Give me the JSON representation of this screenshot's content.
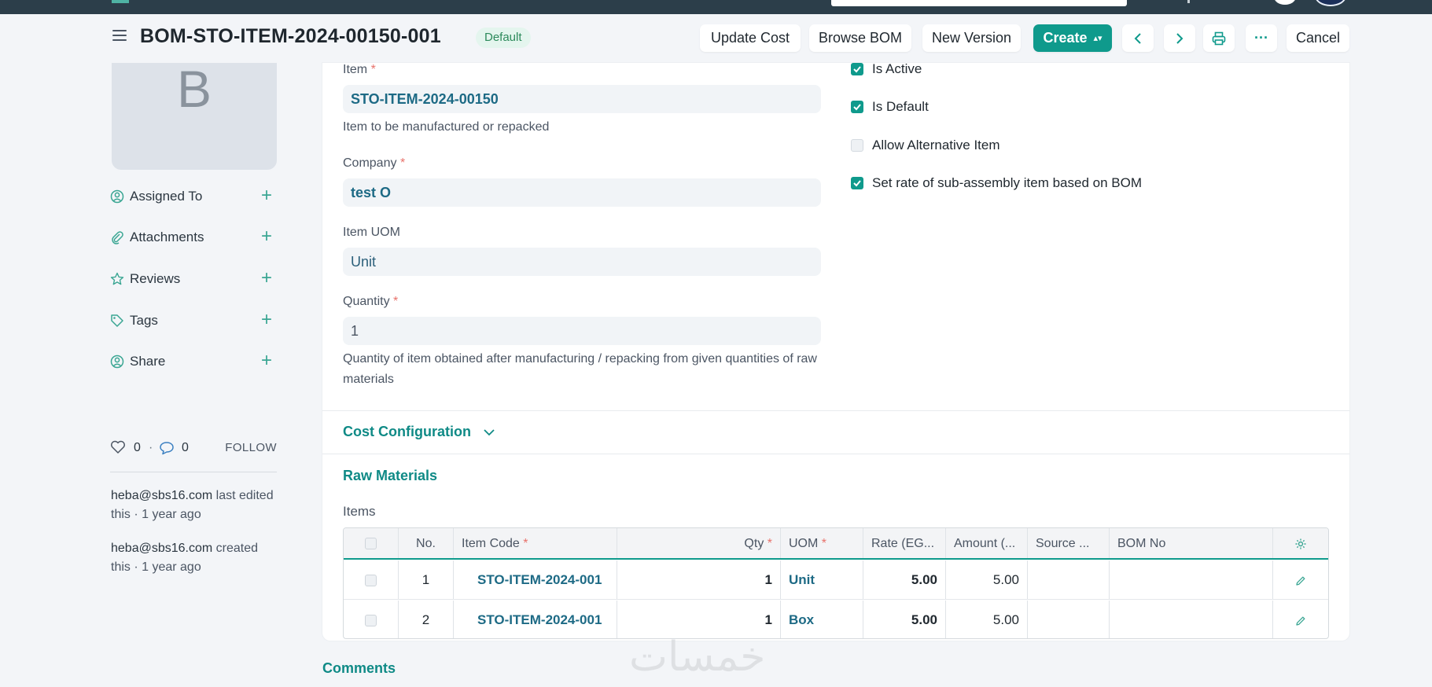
{
  "page": {
    "title": "BOM-STO-ITEM-2024-00150-001",
    "status_badge": "Default"
  },
  "toolbar": {
    "update_cost": "Update Cost",
    "browse_bom": "Browse BOM",
    "new_version": "New Version",
    "create": "Create",
    "more": "···",
    "cancel": "Cancel"
  },
  "sidebar": {
    "avatar_letter": "B",
    "items": [
      {
        "label": "Assigned To",
        "icon": "assign-icon"
      },
      {
        "label": "Attachments",
        "icon": "paperclip-icon"
      },
      {
        "label": "Reviews",
        "icon": "star-icon"
      },
      {
        "label": "Tags",
        "icon": "tag-icon"
      },
      {
        "label": "Share",
        "icon": "share-icon"
      }
    ],
    "likes": "0",
    "comments": "0",
    "follow": "FOLLOW",
    "activity": [
      {
        "user": "heba@sbs16.com",
        "text": " last edited this · 1 year ago"
      },
      {
        "user": "heba@sbs16.com",
        "text": " created this · 1 year ago"
      }
    ]
  },
  "form": {
    "item": {
      "label": "Item",
      "value": "STO-ITEM-2024-00150",
      "help": "Item to be manufactured or repacked"
    },
    "company": {
      "label": "Company",
      "value": "test O"
    },
    "item_uom": {
      "label": "Item UOM",
      "value": "Unit"
    },
    "quantity": {
      "label": "Quantity",
      "value": "1",
      "help": "Quantity of item obtained after manufacturing / repacking from given quantities of raw materials"
    },
    "checks": [
      {
        "label": "Is Active",
        "checked": true
      },
      {
        "label": "Is Default",
        "checked": true
      },
      {
        "label": "Allow Alternative Item",
        "checked": false
      },
      {
        "label": "Set rate of sub-assembly item based on BOM",
        "checked": true
      }
    ]
  },
  "sections": {
    "cost_configuration": "Cost Configuration",
    "raw_materials": "Raw Materials",
    "items_label": "Items",
    "comments": "Comments"
  },
  "table": {
    "columns": {
      "no": "No.",
      "item_code": "Item Code",
      "qty": "Qty",
      "uom": "UOM",
      "rate": "Rate (EG...",
      "amount": "Amount (...",
      "source": "Source ...",
      "bom_no": "BOM No"
    },
    "rows": [
      {
        "no": "1",
        "item_code": "STO-ITEM-2024-001",
        "qty": "1",
        "uom": "Unit",
        "rate": "5.00",
        "amount": "5.00",
        "source": "",
        "bom_no": ""
      },
      {
        "no": "2",
        "item_code": "STO-ITEM-2024-001",
        "qty": "1",
        "uom": "Box",
        "rate": "5.00",
        "amount": "5.00",
        "source": "",
        "bom_no": ""
      }
    ]
  },
  "watermark": "خمسات",
  "colors": {
    "accent": "#0f9a8c",
    "link": "#1d6a85",
    "topbar": "#2c3e4a",
    "badge_bg": "#e4f5ee"
  }
}
